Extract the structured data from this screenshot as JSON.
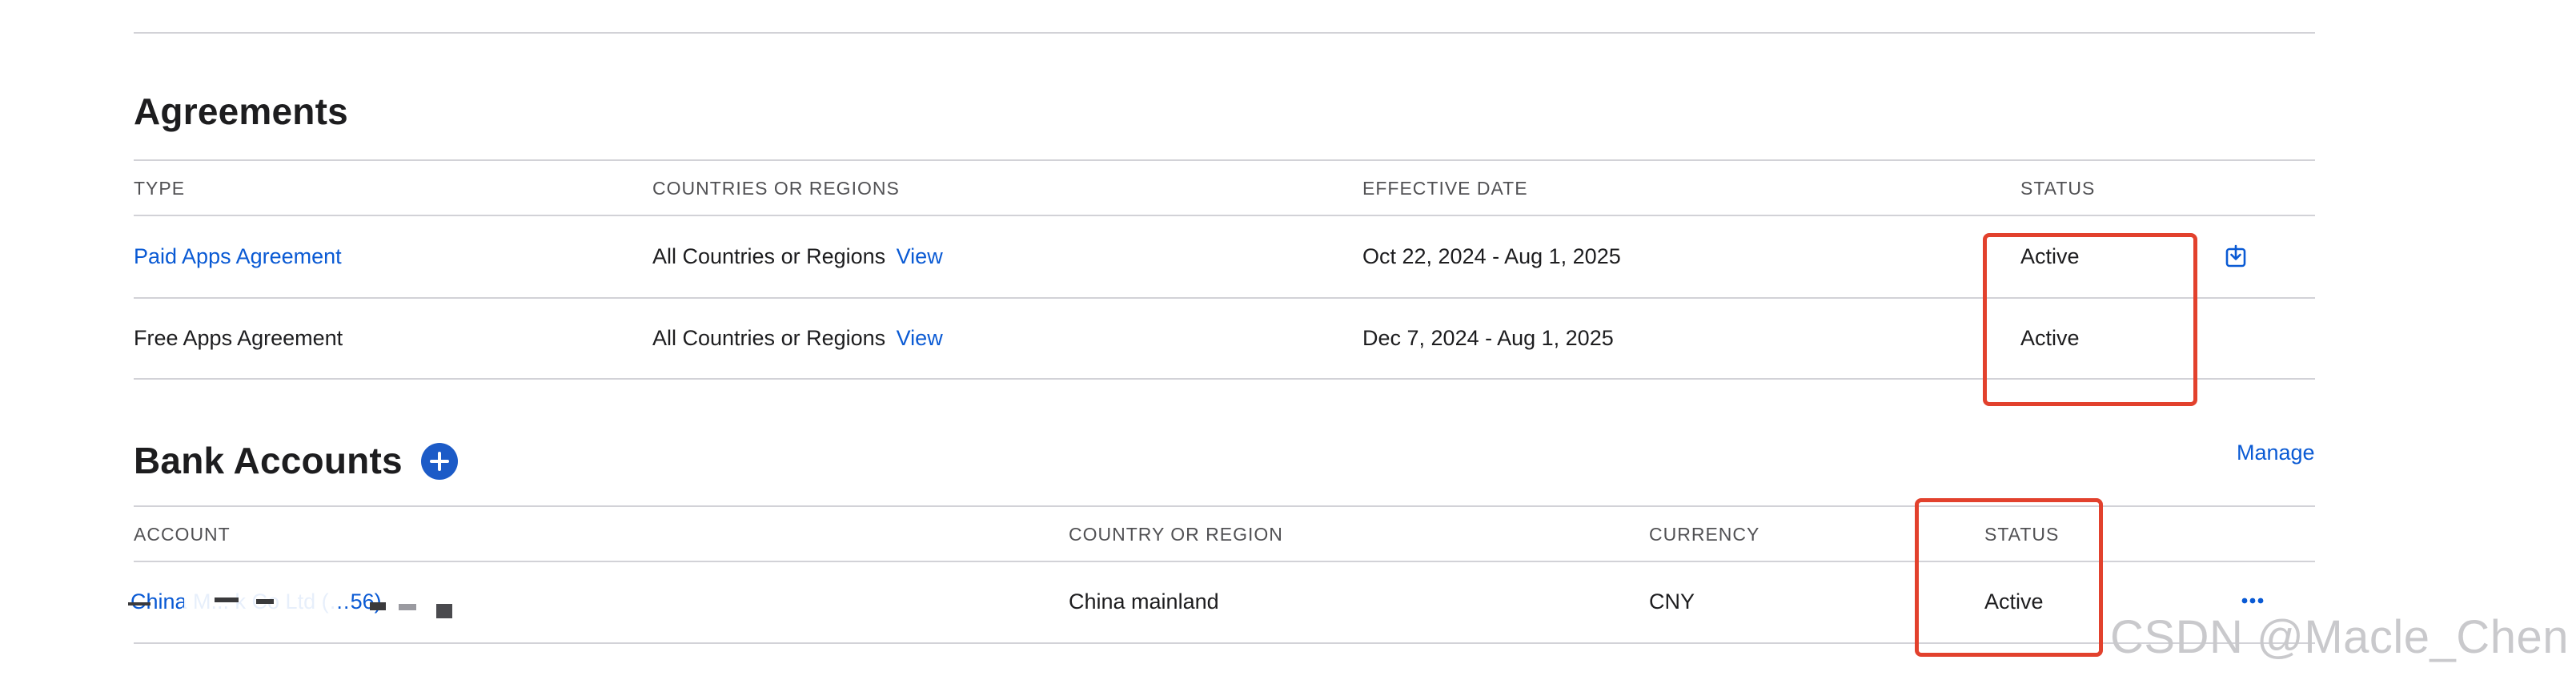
{
  "agreements": {
    "title": "Agreements",
    "columns": {
      "type": "TYPE",
      "countries": "COUNTRIES OR REGIONS",
      "effective_date": "EFFECTIVE DATE",
      "status": "STATUS"
    },
    "rows": [
      {
        "type": "Paid Apps Agreement",
        "countries": "All Countries or Regions",
        "view": "View",
        "effective_date": "Oct 22, 2024 - Aug 1, 2025",
        "status": "Active",
        "action_icon": "download-icon"
      },
      {
        "type": "Free Apps Agreement",
        "countries": "All Countries or Regions",
        "view": "View",
        "effective_date": "Dec 7, 2024 - Aug 1, 2025",
        "status": "Active"
      }
    ]
  },
  "bank_accounts": {
    "title": "Bank Accounts",
    "add_icon": "plus-circle-icon",
    "manage": "Manage",
    "columns": {
      "account": "ACCOUNT",
      "country": "COUNTRY OR REGION",
      "currency": "CURRENCY",
      "status": "STATUS"
    },
    "rows": [
      {
        "account": "China M... k Co Ltd (…56)",
        "country": "China mainland",
        "currency": "CNY",
        "status": "Active",
        "more_icon": "more-icon"
      }
    ]
  },
  "watermark": "CSDN @Macle_Chen",
  "colors": {
    "link": "#0a5ad4",
    "accent": "#1c5bc7",
    "highlight_box": "#e2412d",
    "divider": "#d2d2d7"
  }
}
